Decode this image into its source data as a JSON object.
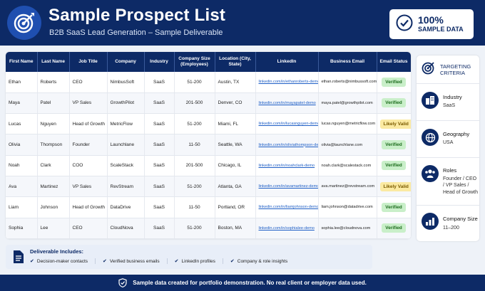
{
  "header": {
    "title": "Sample Prospect List",
    "subtitle": "B2B SaaS Lead Generation – Sample Deliverable",
    "badge_pct": "100%",
    "badge_label": "SAMPLE DATA",
    "logo_icon": "target-icon",
    "badge_icon": "check-circle-icon"
  },
  "table": {
    "headers": [
      "First Name",
      "Last Name",
      "Job Title",
      "Company",
      "Industry",
      "Company Size (Employees)",
      "Location (City, State)",
      "LinkedIn",
      "Business Email",
      "Email Status"
    ],
    "rows": [
      [
        "Ethan",
        "Roberts",
        "CEO",
        "NimbusSoft",
        "SaaS",
        "51-200",
        "Austin, TX",
        "linkedin.com/in/ethanroberts-demo",
        "ethan.roberts@nimbussoft.com",
        "Verified"
      ],
      [
        "Maya",
        "Patel",
        "VP Sales",
        "GrowthPilot",
        "SaaS",
        "201-500",
        "Denver, CO",
        "linkedin.com/in/mayapatel-demo",
        "maya.patel@growthpilot.com",
        "Verified"
      ],
      [
        "Lucas",
        "Nguyen",
        "Head of Growth",
        "MetricFlow",
        "SaaS",
        "51-200",
        "Miami, FL",
        "linkedin.com/in/lucasnguyen-demo",
        "lucas.nguyen@metricflow.com",
        "Likely Valid"
      ],
      [
        "Olivia",
        "Thompson",
        "Founder",
        "Launchlane",
        "SaaS",
        "11-50",
        "Seattle, WA",
        "linkedin.com/in/oliviathompson-demo",
        "olivia@launchlane.com",
        "Verified"
      ],
      [
        "Noah",
        "Clark",
        "COO",
        "ScaleStack",
        "SaaS",
        "201-500",
        "Chicago, IL",
        "linkedin.com/in/noahclark-demo",
        "noah.clark@scalestack.com",
        "Verified"
      ],
      [
        "Ava",
        "Martinez",
        "VP Sales",
        "RevStream",
        "SaaS",
        "51-200",
        "Atlanta, GA",
        "linkedin.com/in/avamartinez-demo",
        "ava.martinez@revstream.com",
        "Likely Valid"
      ],
      [
        "Liam",
        "Johnson",
        "Head of Growth",
        "DataDrive",
        "SaaS",
        "11-50",
        "Portland, OR",
        "linkedin.com/in/liamjohnson-demo",
        "liam.johnson@datadrive.com",
        "Verified"
      ],
      [
        "Sophia",
        "Lee",
        "CEO",
        "CloudNova",
        "SaaS",
        "51-200",
        "Boston, MA",
        "linkedin.com/in/sophialee-demo",
        "sophia.lee@cloudnova.com",
        "Verified"
      ]
    ]
  },
  "deliverable": {
    "title": "Deliverable Includes:",
    "items": [
      "Decision-maker contacts",
      "Verified business emails",
      "LinkedIn profiles",
      "Company & role insights"
    ],
    "icon": "document-icon"
  },
  "sidebar": {
    "heading_line1": "TARGETING",
    "heading_line2": "CRITERIA",
    "criteria": [
      {
        "label": "Industry",
        "value": "SaaS",
        "icon": "buildings-icon"
      },
      {
        "label": "Geography",
        "value": "USA",
        "icon": "globe-icon"
      },
      {
        "label": "Roles",
        "value": "Founder / CEO / VP Sales / Head of Growth",
        "icon": "people-icon"
      },
      {
        "label": "Company Size",
        "value": "11–200",
        "icon": "bar-chart-icon"
      }
    ]
  },
  "footer": {
    "text": "Sample data created for portfolio demonstration. No real client or employer data used.",
    "icon": "shield-check-icon"
  },
  "colors": {
    "navy": "#0d2a66",
    "verified_bg": "#c9efc9",
    "likely_bg": "#fbeaa2",
    "link": "#1f5fc6"
  }
}
